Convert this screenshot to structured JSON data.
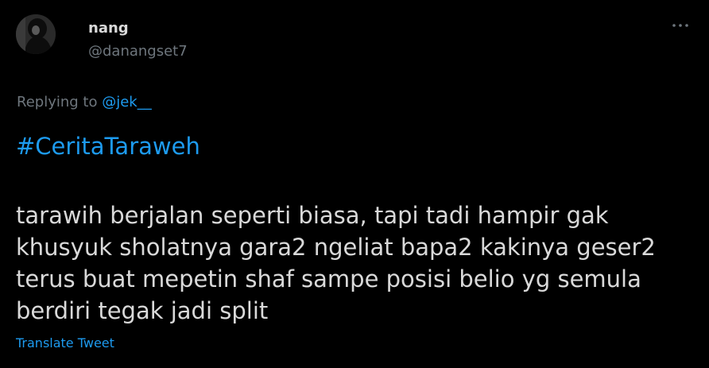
{
  "author": {
    "display_name": "nang",
    "username": "@danangset7"
  },
  "replying": {
    "prefix": "Replying to ",
    "mention": "@jek__"
  },
  "tweet": {
    "hashtag": "#CeritaTaraweh",
    "lines": [
      "tarawih berjalan seperti biasa, tapi tadi hampir gak",
      "khusyuk sholatnya gara2 ngeliat bapa2 kakinya geser2",
      "terus buat mepetin shaf sampe posisi belio yg semula",
      "berdiri tegak jadi split"
    ]
  },
  "actions": {
    "translate_label": "Translate Tweet"
  },
  "icons": {
    "more": "more-horizontal-icon"
  },
  "colors": {
    "background": "#000000",
    "text": "#d9d9d9",
    "muted": "#6e767d",
    "accent": "#1d9bf0"
  }
}
